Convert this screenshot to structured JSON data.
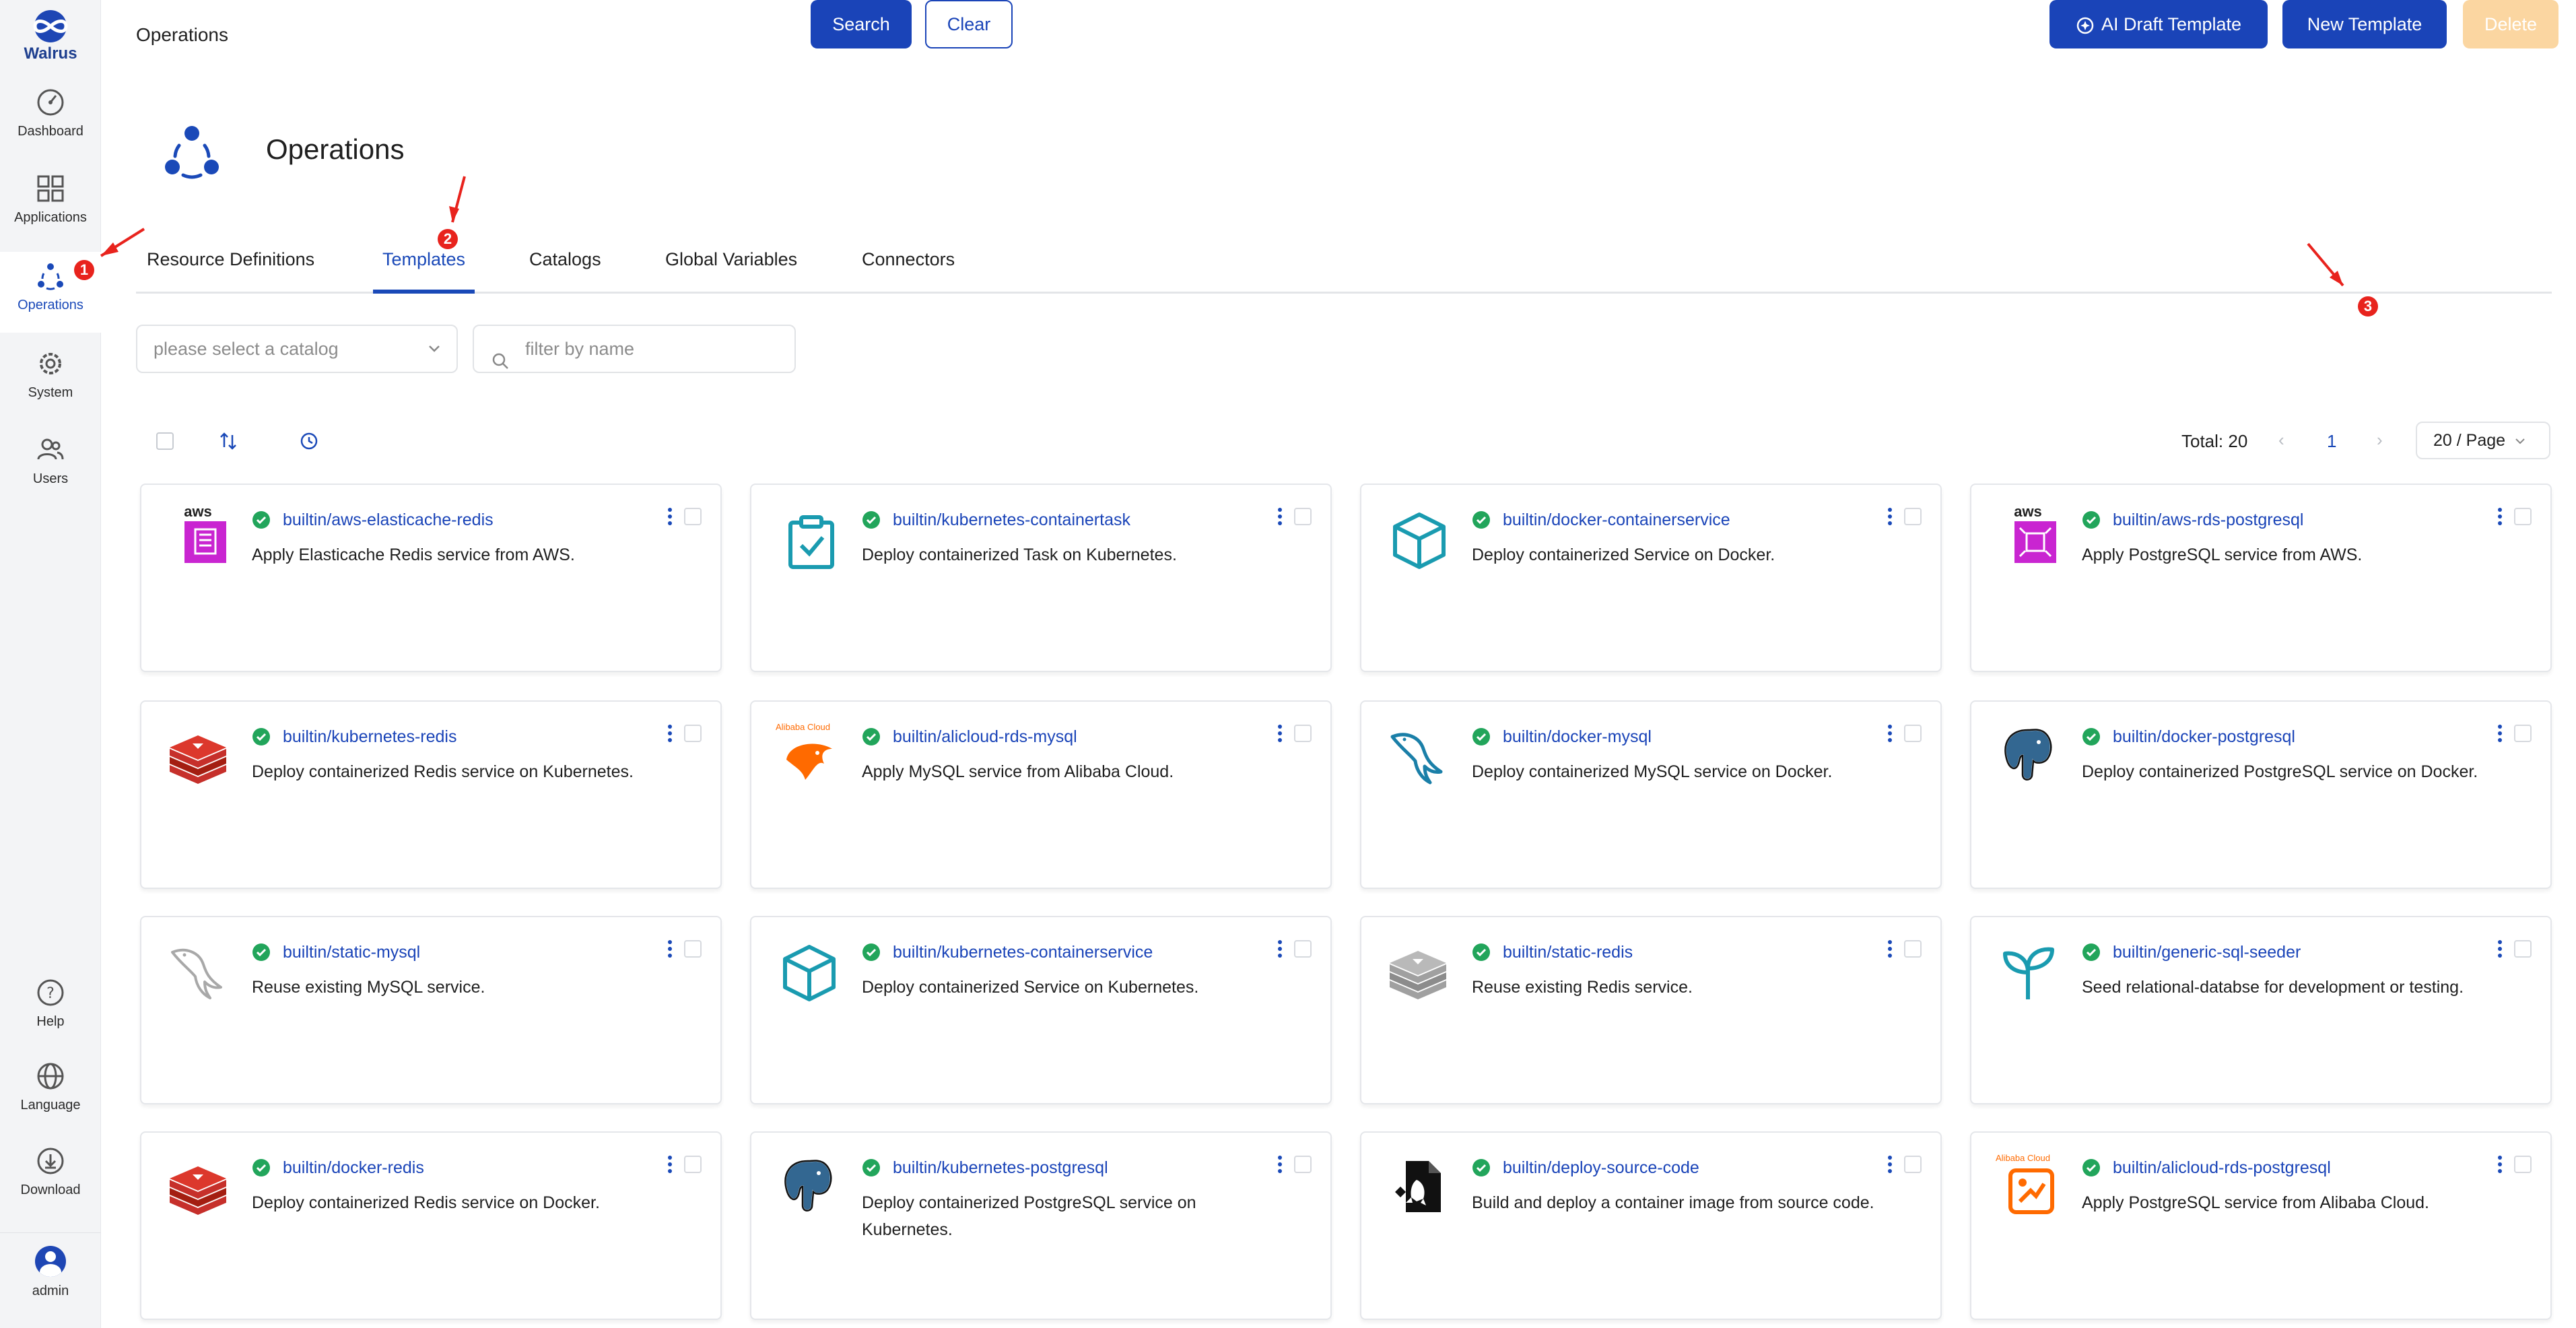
{
  "app": {
    "logo_text": "Walrus"
  },
  "sidebar": {
    "items": [
      {
        "label": "Dashboard"
      },
      {
        "label": "Applications"
      },
      {
        "label": "Operations"
      },
      {
        "label": "System"
      },
      {
        "label": "Users"
      }
    ],
    "bottom": [
      {
        "label": "Help"
      },
      {
        "label": "Language"
      },
      {
        "label": "Download"
      },
      {
        "label": "admin"
      }
    ]
  },
  "header": {
    "breadcrumb": "Operations",
    "title": "Operations"
  },
  "tabs": [
    "Resource Definitions",
    "Templates",
    "Catalogs",
    "Global Variables",
    "Connectors"
  ],
  "filters": {
    "catalog_placeholder": "please select a catalog",
    "search_placeholder": "filter by name",
    "search_label": "Search",
    "clear_label": "Clear"
  },
  "actions": {
    "ai_draft_label": "AI Draft Template",
    "new_template_label": "New Template",
    "delete_label": "Delete"
  },
  "pagination": {
    "total": "Total: 20",
    "page": "1",
    "page_size": "20 / Page"
  },
  "markers": [
    "1",
    "2",
    "3"
  ],
  "colors": {
    "primary": "#1a44b8",
    "status_ok": "#22a55b",
    "annotation": "#e8231d"
  },
  "templates": [
    {
      "title": "builtin/aws-elasticache-redis",
      "desc": "Apply Elasticache Redis service from AWS.",
      "icon": "aws-elasticache-icon"
    },
    {
      "title": "builtin/kubernetes-containertask",
      "desc": "Deploy containerized Task on Kubernetes.",
      "icon": "clipboard-check-icon"
    },
    {
      "title": "builtin/docker-containerservice",
      "desc": "Deploy containerized Service on Docker.",
      "icon": "cube-icon"
    },
    {
      "title": "builtin/aws-rds-postgresql",
      "desc": "Apply PostgreSQL service from AWS.",
      "icon": "aws-rds-icon"
    },
    {
      "title": "builtin/kubernetes-redis",
      "desc": "Deploy containerized Redis service on Kubernetes.",
      "icon": "redis-icon"
    },
    {
      "title": "builtin/alicloud-rds-mysql",
      "desc": "Apply MySQL service from Alibaba Cloud.",
      "icon": "alibaba-mysql-icon"
    },
    {
      "title": "builtin/docker-mysql",
      "desc": "Deploy containerized MySQL service on Docker.",
      "icon": "mysql-dolphin-icon"
    },
    {
      "title": "builtin/docker-postgresql",
      "desc": "Deploy containerized PostgreSQL service on Docker.",
      "icon": "postgresql-elephant-icon"
    },
    {
      "title": "builtin/static-mysql",
      "desc": "Reuse existing MySQL service.",
      "icon": "mysql-dolphin-outline-icon"
    },
    {
      "title": "builtin/kubernetes-containerservice",
      "desc": "Deploy containerized Service on Kubernetes.",
      "icon": "cube-icon"
    },
    {
      "title": "builtin/static-redis",
      "desc": "Reuse existing Redis service.",
      "icon": "redis-gray-icon"
    },
    {
      "title": "builtin/generic-sql-seeder",
      "desc": "Seed relational-databse for development or testing.",
      "icon": "sprout-icon"
    },
    {
      "title": "builtin/docker-redis",
      "desc": "Deploy containerized Redis service on Docker.",
      "icon": "redis-icon"
    },
    {
      "title": "builtin/kubernetes-postgresql",
      "desc": "Deploy containerized PostgreSQL service on Kubernetes.",
      "icon": "postgresql-elephant-icon"
    },
    {
      "title": "builtin/deploy-source-code",
      "desc": "Build and deploy a container image from source code.",
      "icon": "rocket-file-icon"
    },
    {
      "title": "builtin/alicloud-rds-postgresql",
      "desc": "Apply PostgreSQL service from Alibaba Cloud.",
      "icon": "alibaba-rds-icon"
    }
  ],
  "vendor_labels": {
    "aws": "aws",
    "alibaba": "Alibaba Cloud"
  }
}
